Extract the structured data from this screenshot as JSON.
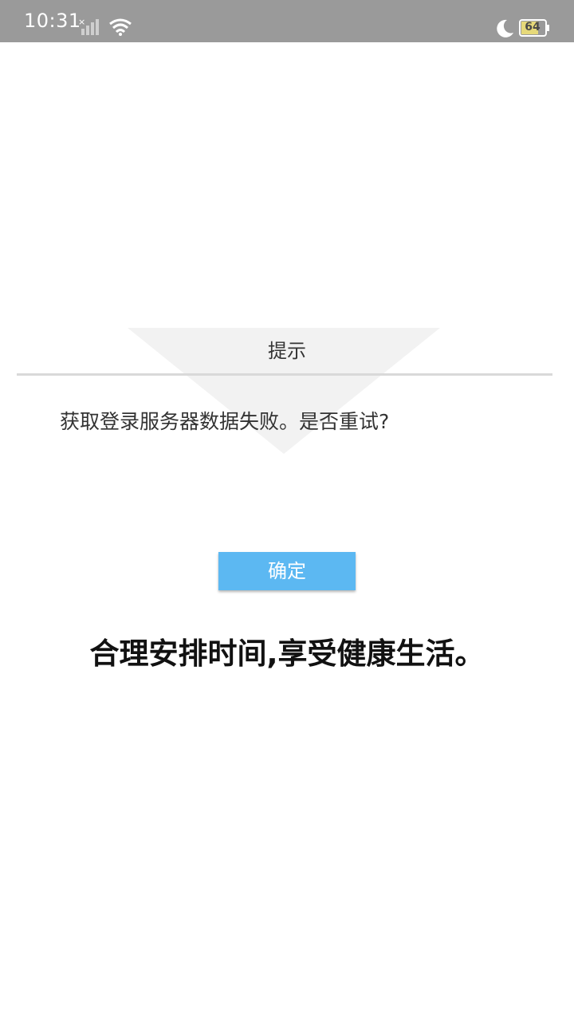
{
  "status_bar": {
    "time": "10:31",
    "battery_level": "64",
    "icons": [
      "signal-icon",
      "wifi-icon",
      "moon-icon",
      "battery-icon"
    ],
    "background_color": "#9a9a9a"
  },
  "dialog": {
    "title": "提示",
    "message": "获取登录服务器数据失败。是否重试?",
    "confirm_label": "确定",
    "confirm_color": "#5cb8f2"
  },
  "slogan": "合理安排时间,享受健康生活。"
}
